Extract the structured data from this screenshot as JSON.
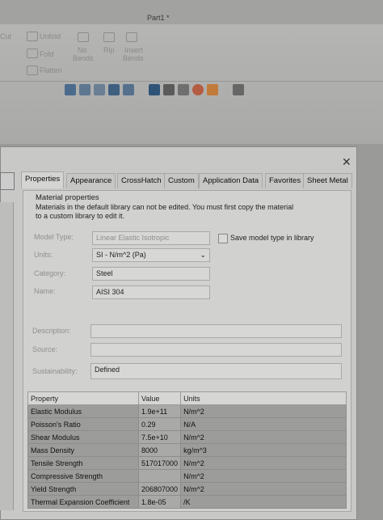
{
  "window": {
    "doc_title": "Part1 *"
  },
  "ribbon": {
    "cut": "Cut",
    "unfold": "Unfold",
    "fold": "Fold",
    "flatten": "Flatten",
    "no_bends_1": "No",
    "no_bends_2": "Bends",
    "rip": "Rip",
    "insert_bends_1": "Insert",
    "insert_bends_2": "Bends"
  },
  "dialog": {
    "tabs": [
      {
        "label": "Properties"
      },
      {
        "label": "Appearance"
      },
      {
        "label": "CrossHatch"
      },
      {
        "label": "Custom"
      },
      {
        "label": "Application Data"
      },
      {
        "label": "Favorites"
      },
      {
        "label": "Sheet Metal"
      }
    ],
    "section_title": "Material properties",
    "notice": "Materials in the default library can not be edited. You must first copy the material",
    "notice2": "to a custom library to edit it.",
    "model_type_label": "Model Type:",
    "model_type_value": "Linear Elastic Isotropic",
    "save_model_type": "Save model type in library",
    "units_label": "Units:",
    "units_value": "SI - N/m^2 (Pa)",
    "category_label": "Category:",
    "category_value": "Steel",
    "name_label": "Name:",
    "name_value": "AISI 304",
    "description_label": "Description:",
    "source_label": "Source:",
    "sustainability_label": "Sustainability:",
    "sustainability_value": "Defined",
    "table": {
      "headers": [
        "Property",
        "Value",
        "Units"
      ],
      "rows": [
        [
          "Elastic Modulus",
          "1.9e+11",
          "N/m^2"
        ],
        [
          "Poisson's Ratio",
          "0.29",
          "N/A"
        ],
        [
          "Shear Modulus",
          "7.5e+10",
          "N/m^2"
        ],
        [
          "Mass Density",
          "8000",
          "kg/m^3"
        ],
        [
          "Tensile Strength",
          "517017000",
          "N/m^2"
        ],
        [
          "Compressive Strength",
          "",
          "N/m^2"
        ],
        [
          "Yield Strength",
          "206807000",
          "N/m^2"
        ],
        [
          "Thermal Expansion Coefficient",
          "1.8e-05",
          "/K"
        ]
      ]
    }
  },
  "colors": {
    "annotation_mark": "#f2541b"
  }
}
